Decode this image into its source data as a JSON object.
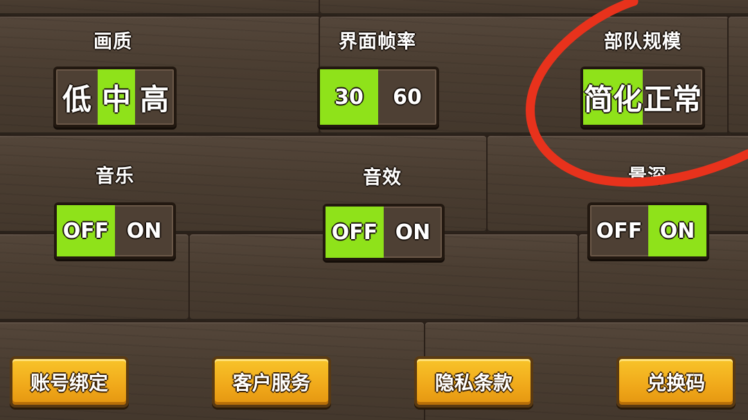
{
  "settings": {
    "quality": {
      "label": "画质",
      "options": [
        "低",
        "中",
        "高"
      ],
      "selected": "中"
    },
    "framerate": {
      "label": "界面帧率",
      "options": [
        "30",
        "60"
      ],
      "selected": "30"
    },
    "army_size": {
      "label": "部队规模",
      "options": [
        "简化",
        "正常"
      ],
      "selected": "简化"
    },
    "music": {
      "label": "音乐",
      "options": [
        "OFF",
        "ON"
      ],
      "selected": "OFF"
    },
    "sound": {
      "label": "音效",
      "options": [
        "OFF",
        "ON"
      ],
      "selected": "OFF"
    },
    "depth_of_field": {
      "label": "景深",
      "options": [
        "OFF",
        "ON"
      ],
      "selected": "ON"
    }
  },
  "buttons": {
    "account_binding": "账号绑定",
    "customer_service": "客户服务",
    "privacy_terms": "隐私条款",
    "redeem_code": "兑换码"
  },
  "colors": {
    "active_green": "#8fe21a",
    "button_orange": "#f0a81a",
    "annotation_red": "#e8321c"
  }
}
